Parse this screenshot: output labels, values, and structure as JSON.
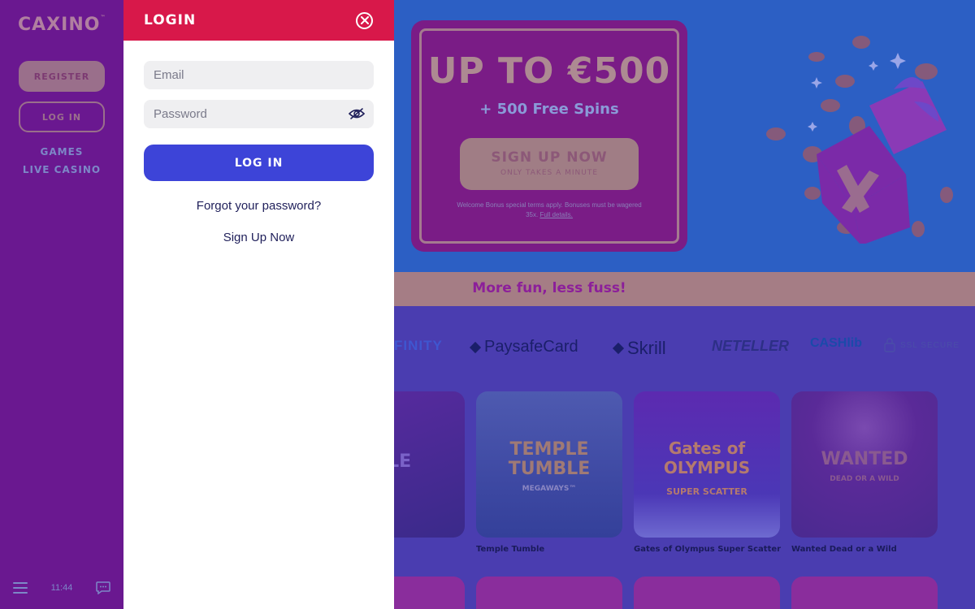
{
  "sidebar": {
    "logo": "CAXINO",
    "logo_mark": "™",
    "register_label": "REGISTER",
    "login_label": "LOG IN",
    "nav_games": "GAMES",
    "nav_live_casino": "LIVE CASINO",
    "time": "11:44"
  },
  "promo": {
    "title": "UP TO €500",
    "subtitle": "+ 500 Free Spins",
    "cta_line1": "SIGN UP NOW",
    "cta_line2": "ONLY TAKES A MINUTE",
    "terms": "Welcome Bonus special terms apply. Bonuses must be wagered 35x.",
    "terms_link": "Full details."
  },
  "tagline": "More fun, less fuss!",
  "payments": {
    "infinity": "FINITY",
    "paysafecard": "PaysafeCard",
    "skrill": "Skrill",
    "neteller": "NETELLER",
    "cashlib": "CASHlib",
    "ssl": "SSL SECURE"
  },
  "games": [
    {
      "art": "HOLE",
      "name": ""
    },
    {
      "art": "TEMPLE TUMBLE",
      "sub": "MEGAWAYS™",
      "name": "Temple Tumble"
    },
    {
      "art": "Gates of OLYMPUS",
      "sub": "SUPER SCATTER",
      "name": "Gates of Olympus Super Scatter"
    },
    {
      "art": "WANTED",
      "sub": "DEAD OR A WILD",
      "name": "Wanted Dead or a Wild"
    }
  ],
  "login_modal": {
    "title": "LOGIN",
    "email_placeholder": "Email",
    "password_placeholder": "Password",
    "submit_label": "LOG IN",
    "forgot_label": "Forgot your password?",
    "signup_label": "Sign Up Now"
  },
  "colors": {
    "header_red": "#d8184a",
    "button_blue": "#3d44d8",
    "sidebar_purple": "#6a1890",
    "hero_blue": "#2c5fc4"
  }
}
